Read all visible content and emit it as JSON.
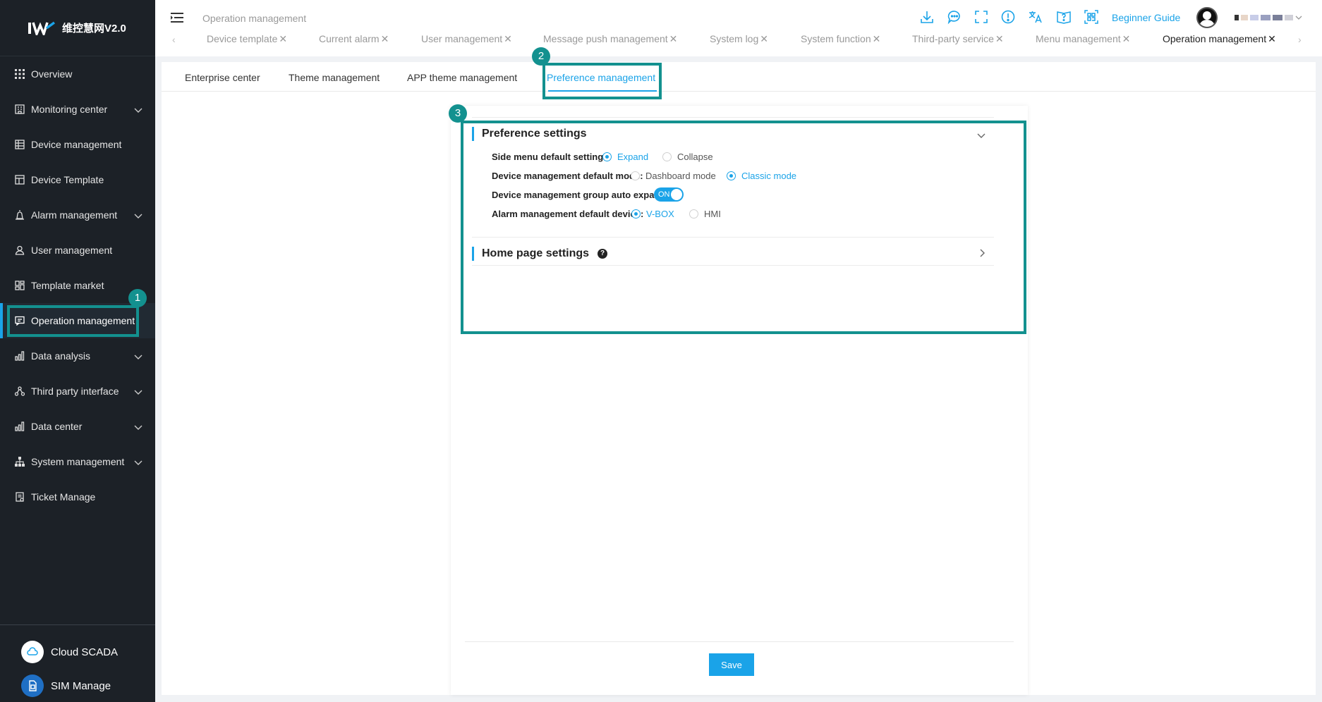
{
  "app": {
    "logo_text": "维控慧网V2.0"
  },
  "colors": {
    "accent": "#1aa3e8",
    "sidebar_bg": "#1c2127",
    "annotation": "#13918f"
  },
  "sidebar": {
    "items": [
      {
        "label": "Overview",
        "icon": "grid-icon",
        "has_children": false
      },
      {
        "label": "Monitoring center",
        "icon": "building-icon",
        "has_children": true
      },
      {
        "label": "Device management",
        "icon": "list-icon",
        "has_children": false
      },
      {
        "label": "Device Template",
        "icon": "template-icon",
        "has_children": false
      },
      {
        "label": "Alarm management",
        "icon": "alarm-icon",
        "has_children": true
      },
      {
        "label": "User management",
        "icon": "user-icon",
        "has_children": false
      },
      {
        "label": "Template market",
        "icon": "market-icon",
        "has_children": false
      },
      {
        "label": "Operation management",
        "icon": "message-icon",
        "has_children": false
      },
      {
        "label": "Data analysis",
        "icon": "bar-chart-icon",
        "has_children": true
      },
      {
        "label": "Third party interface",
        "icon": "network-icon",
        "has_children": true
      },
      {
        "label": "Data center",
        "icon": "bar-chart-icon",
        "has_children": true
      },
      {
        "label": "System management",
        "icon": "hierarchy-icon",
        "has_children": true
      },
      {
        "label": "Ticket Manage",
        "icon": "ticket-icon",
        "has_children": false
      }
    ],
    "bottom": [
      {
        "label": "Cloud SCADA",
        "icon": "cloud-icon"
      },
      {
        "label": "SIM Manage",
        "icon": "sim-icon"
      }
    ]
  },
  "header": {
    "breadcrumb": "Operation management",
    "beginner_guide": "Beginner Guide",
    "tabs": [
      {
        "label": "Device template"
      },
      {
        "label": "Current alarm"
      },
      {
        "label": "User management"
      },
      {
        "label": "Message push management"
      },
      {
        "label": "System log"
      },
      {
        "label": "System function"
      },
      {
        "label": "Third-party service"
      },
      {
        "label": "Menu management"
      },
      {
        "label": "Operation management"
      }
    ],
    "tab_prev": "‹",
    "tab_next": "›",
    "tab_close": "✕",
    "toolbar_icons": [
      "download-icon",
      "chat-icon",
      "fullscreen-icon",
      "alert-icon",
      "translate-icon",
      "help-book-icon",
      "qr-scan-icon"
    ]
  },
  "subtabs": [
    {
      "label": "Enterprise center"
    },
    {
      "label": "Theme management"
    },
    {
      "label": "APP theme management"
    },
    {
      "label": "Preference management"
    }
  ],
  "preference": {
    "title": "Preference settings",
    "side_menu": {
      "label": "Side menu default settings:",
      "options": [
        "Expand",
        "Collapse"
      ],
      "selected": "Expand"
    },
    "device_mode": {
      "label": "Device management default mode:",
      "options": [
        "Dashboard mode",
        "Classic mode"
      ],
      "selected": "Classic mode"
    },
    "group_expand": {
      "label": "Device management group auto expand:",
      "switch_text": "ON"
    },
    "alarm_device": {
      "label": "Alarm management default device:",
      "options": [
        "V-BOX",
        "HMI"
      ],
      "selected": "V-BOX"
    }
  },
  "home_page": {
    "title": "Home page settings",
    "help": "?"
  },
  "save_label": "Save",
  "annotations": {
    "badge1": "1",
    "badge2": "2",
    "badge3": "3"
  }
}
